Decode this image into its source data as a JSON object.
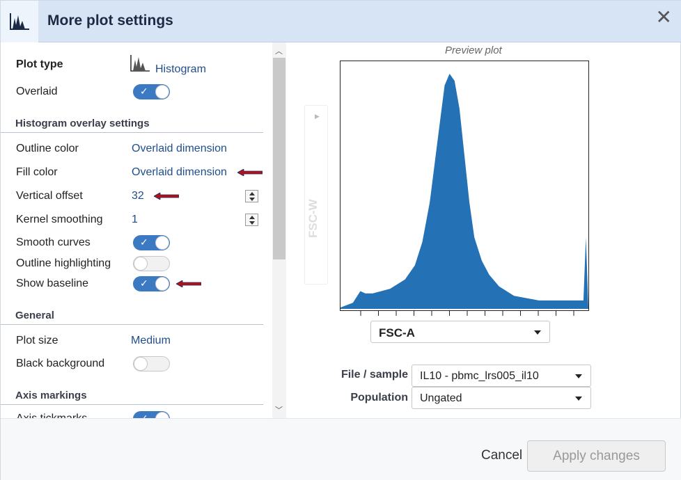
{
  "header": {
    "title": "More plot settings",
    "close_glyph": "✕"
  },
  "settings": {
    "plot_type": {
      "label": "Plot type",
      "value": "Histogram"
    },
    "overlaid": {
      "label": "Overlaid",
      "on": true
    },
    "histogram_section": "Histogram overlay settings",
    "outline_color": {
      "label": "Outline color",
      "value": "Overlaid dimension"
    },
    "fill_color": {
      "label": "Fill color",
      "value": "Overlaid dimension"
    },
    "vertical_offset": {
      "label": "Vertical offset",
      "value": "32"
    },
    "kernel_smoothing": {
      "label": "Kernel smoothing",
      "value": "1"
    },
    "smooth_curves": {
      "label": "Smooth curves",
      "on": true
    },
    "outline_highlighting": {
      "label": "Outline highlighting",
      "on": false
    },
    "show_baseline": {
      "label": "Show baseline",
      "on": true
    },
    "general_section": "General",
    "plot_size": {
      "label": "Plot size",
      "value": "Medium"
    },
    "black_background": {
      "label": "Black background",
      "on": false
    },
    "axis_section": "Axis markings",
    "axis_tickmarks": {
      "label": "Axis tickmarks",
      "on": true
    }
  },
  "preview": {
    "title": "Preview plot",
    "y_axis": "FSC-W",
    "x_axis_select": "FSC-A",
    "file_label": "File / sample",
    "file_value": "IL10 - pbmc_lrs005_il10",
    "population_label": "Population",
    "population_value": "Ungated"
  },
  "chart_data": {
    "type": "area",
    "xlabel": "FSC-A",
    "ylabel": "FSC-W",
    "x": [
      0,
      0.05,
      0.08,
      0.1,
      0.13,
      0.2,
      0.26,
      0.3,
      0.33,
      0.36,
      0.39,
      0.42,
      0.44,
      0.46,
      0.48,
      0.5,
      0.52,
      0.54,
      0.57,
      0.6,
      0.64,
      0.7,
      0.8,
      0.9,
      0.98,
      0.99,
      1.0
    ],
    "values": [
      0,
      0.02,
      0.07,
      0.06,
      0.06,
      0.08,
      0.12,
      0.18,
      0.28,
      0.45,
      0.7,
      0.95,
      1.0,
      0.97,
      0.85,
      0.65,
      0.45,
      0.3,
      0.2,
      0.14,
      0.09,
      0.05,
      0.03,
      0.03,
      0.03,
      0.3,
      0.0
    ],
    "series_color": "#2472b5",
    "grid": false
  },
  "footer": {
    "cancel": "Cancel",
    "apply": "Apply changes"
  },
  "colors": {
    "accent": "#3b79c3",
    "link": "#1f4e8c",
    "header_bg": "#d6e4f5",
    "arrow": "#b0121a"
  }
}
